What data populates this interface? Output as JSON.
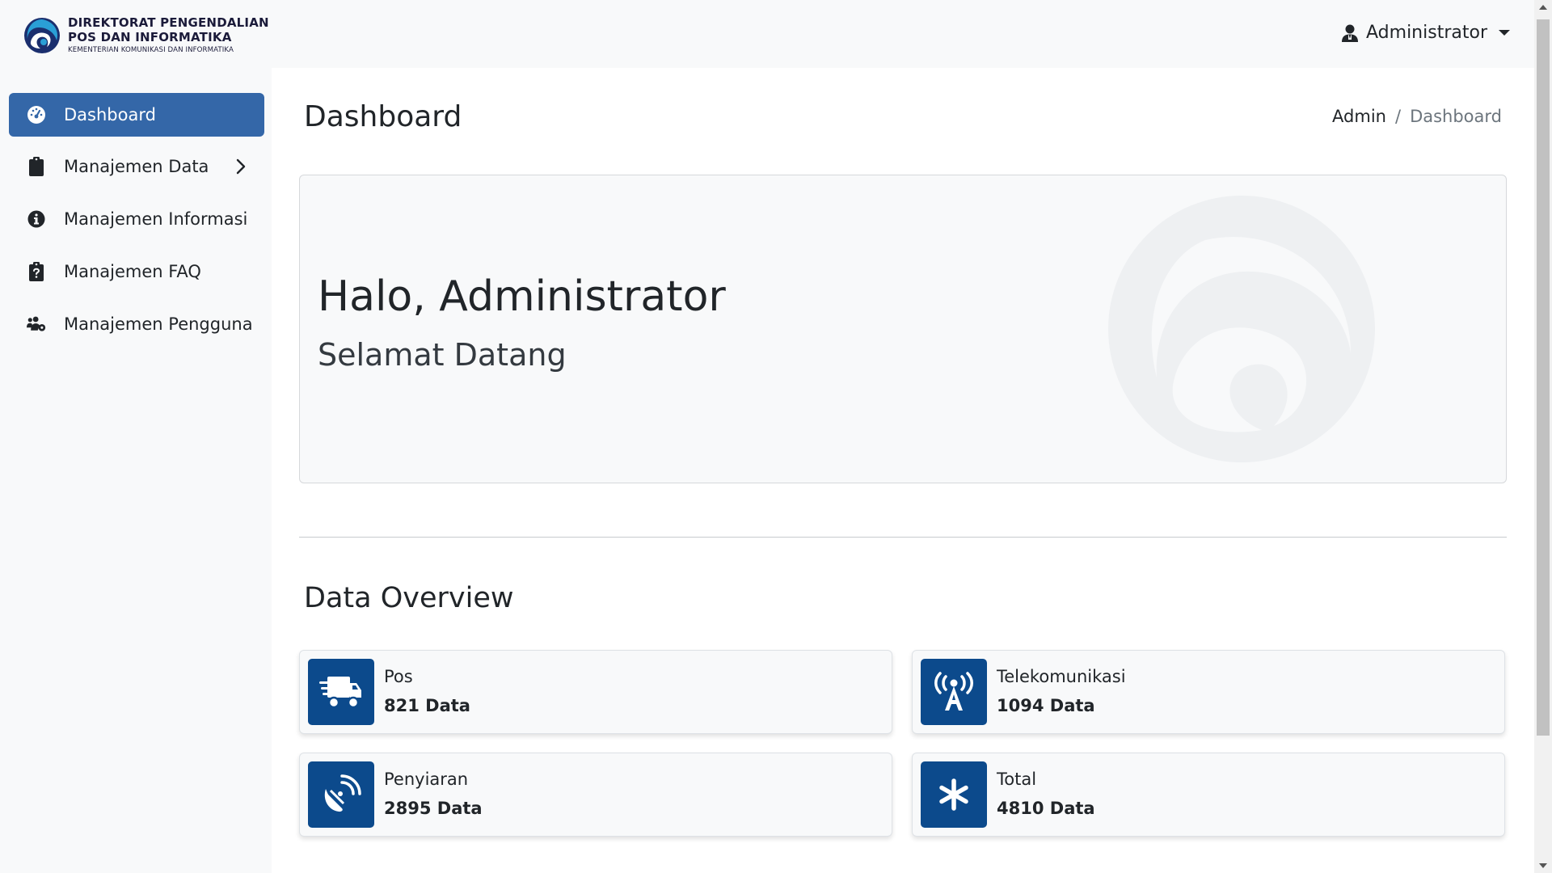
{
  "brand": {
    "line1": "DIREKTORAT PENGENDALIAN",
    "line2": "POS DAN INFORMATIKA",
    "line3": "KEMENTERIAN KOMUNIKASI DAN INFORMATIKA",
    "logo_icon": "kominfo-logo-icon"
  },
  "user_menu": {
    "name": "Administrator",
    "icon": "user-icon"
  },
  "sidebar": {
    "items": [
      {
        "label": "Dashboard",
        "icon": "dashboard-gauge-icon",
        "active": true
      },
      {
        "label": "Manajemen Data",
        "icon": "clipboard-icon",
        "has_submenu": true
      },
      {
        "label": "Manajemen Informasi",
        "icon": "info-circle-icon"
      },
      {
        "label": "Manajemen FAQ",
        "icon": "clipboard-question-icon"
      },
      {
        "label": "Manajemen Pengguna",
        "icon": "users-gear-icon"
      }
    ]
  },
  "page": {
    "title": "Dashboard",
    "breadcrumb": [
      "Admin",
      "Dashboard"
    ],
    "breadcrumb_sep": "/"
  },
  "hero": {
    "greeting": "Halo, Administrator",
    "subtitle": "Selamat Datang"
  },
  "overview": {
    "title": "Data Overview",
    "cards": [
      {
        "label": "Pos",
        "value": "821 Data",
        "icon": "truck-fast-icon"
      },
      {
        "label": "Telekomunikasi",
        "value": "1094 Data",
        "icon": "tower-broadcast-icon"
      },
      {
        "label": "Penyiaran",
        "value": "2895 Data",
        "icon": "satellite-dish-icon"
      },
      {
        "label": "Total",
        "value": "4810 Data",
        "icon": "asterisk-icon"
      }
    ]
  },
  "colors": {
    "accent": "#3467a8",
    "card_icon_bg": "#0c4a8c"
  }
}
